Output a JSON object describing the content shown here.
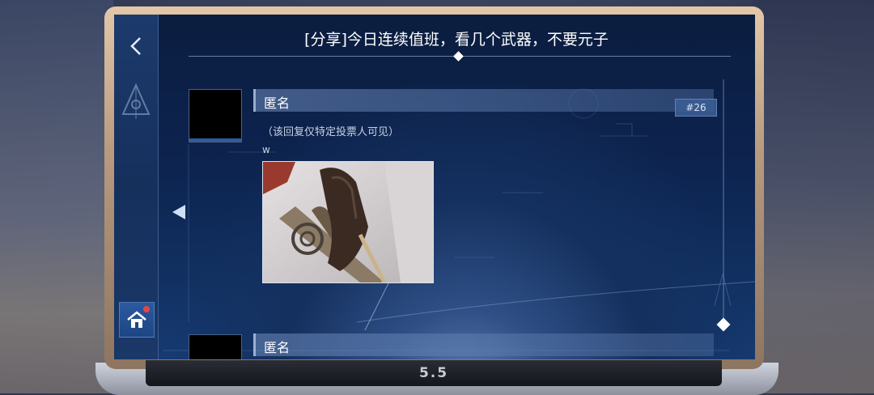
{
  "header": {
    "title": "[分享]今日连续值班，看几个武器，不要元子"
  },
  "laptop": {
    "logo": "5.5"
  },
  "sidebar": {
    "back_icon": "chevron-left-icon",
    "home_icon": "home-icon",
    "home_has_notification": true
  },
  "posts": [
    {
      "author": "匿名",
      "floor": "#26",
      "visibility_note": "（该回复仅特定投票人可见）",
      "text": "w",
      "has_image": true
    },
    {
      "author": "匿名"
    }
  ],
  "colors": {
    "screen_bg": "#0d2450",
    "accent": "#2c5aa0",
    "notification": "#e54545"
  }
}
